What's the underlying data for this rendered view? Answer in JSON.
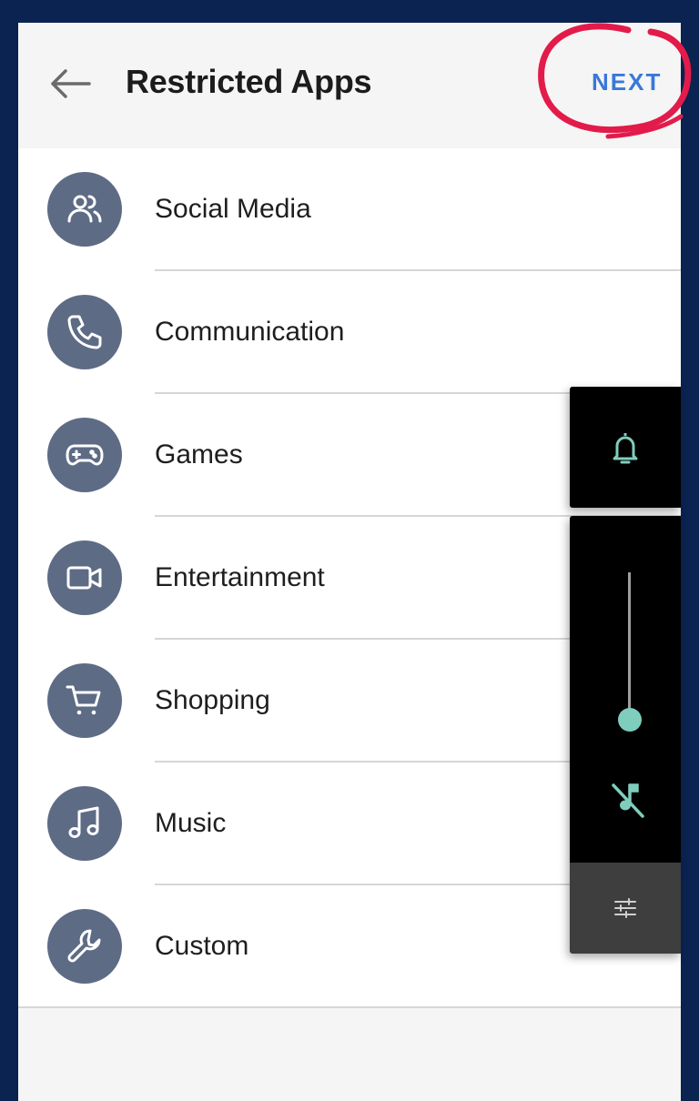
{
  "app": {
    "title": "Restricted Apps",
    "next_label": "NEXT"
  },
  "categories": [
    {
      "label": "Social Media",
      "icon": "people-icon"
    },
    {
      "label": "Communication",
      "icon": "phone-icon"
    },
    {
      "label": "Games",
      "icon": "gamepad-icon"
    },
    {
      "label": "Entertainment",
      "icon": "video-camera-icon"
    },
    {
      "label": "Shopping",
      "icon": "shopping-cart-icon"
    },
    {
      "label": "Music",
      "icon": "music-note-icon"
    },
    {
      "label": "Custom",
      "icon": "wrench-icon"
    }
  ],
  "volume_panel": {
    "level": 0.05,
    "accent_color": "#7fcdbd",
    "icons": [
      "bell-icon",
      "music-muted-icon",
      "settings-sliders-icon"
    ]
  },
  "colors": {
    "background": "#0b2350",
    "accent": "#3a78d8",
    "icon_circle": "#5e6b85",
    "annotation": "#e31b4a"
  }
}
